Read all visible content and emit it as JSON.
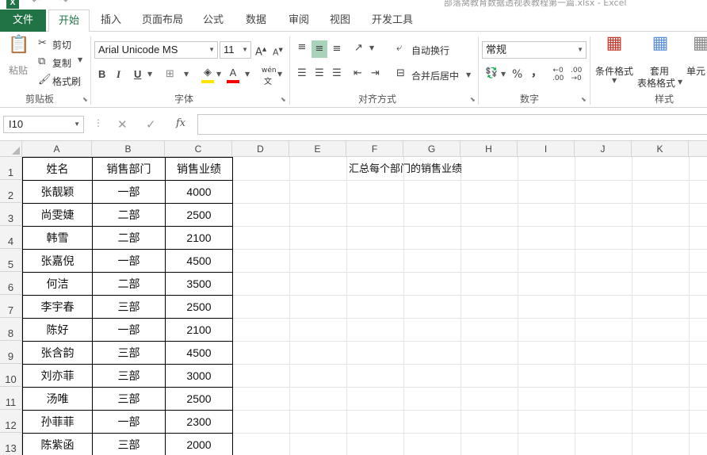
{
  "titlebar": {
    "logo": "X",
    "window_title": "部落窝教育数据透视表教程第一篇.xlsx - Excel"
  },
  "tabs": [
    "文件",
    "开始",
    "插入",
    "页面布局",
    "公式",
    "数据",
    "审阅",
    "视图",
    "开发工具"
  ],
  "ribbon": {
    "clipboard": {
      "paste": "粘贴",
      "cut": "剪切",
      "copy": "复制",
      "format_painter": "格式刷",
      "label": "剪贴板"
    },
    "font": {
      "font_name": "Arial Unicode MS",
      "font_size": "11",
      "bold": "B",
      "italic": "I",
      "underline": "U",
      "phonetic_top": "wén",
      "phonetic_bottom": "文",
      "label": "字体"
    },
    "alignment": {
      "wrap_text": "自动换行",
      "merge_center": "合并后居中",
      "label": "对齐方式"
    },
    "number": {
      "format": "常规",
      "percent": "%",
      "comma": "，",
      "label": "数字"
    },
    "styles": {
      "conditional_formatting": "条件格式",
      "format_table_1": "套用",
      "format_table_2": "表格格式",
      "cell_styles": "单元",
      "label": "样式"
    }
  },
  "formula_bar": {
    "name_box": "I10",
    "fx": "fx",
    "formula": ""
  },
  "grid": {
    "columns": [
      "A",
      "B",
      "C",
      "D",
      "E",
      "F",
      "G",
      "H",
      "I",
      "J",
      "K"
    ],
    "rows": [
      "1",
      "2",
      "3",
      "4",
      "5",
      "6",
      "7",
      "8",
      "9",
      "10",
      "11",
      "12",
      "13"
    ],
    "table": [
      [
        "姓名",
        "销售部门",
        "销售业绩"
      ],
      [
        "张靓颖",
        "一部",
        "4000"
      ],
      [
        "尚雯婕",
        "二部",
        "2500"
      ],
      [
        "韩雪",
        "二部",
        "2100"
      ],
      [
        "张嘉倪",
        "一部",
        "4500"
      ],
      [
        "何洁",
        "二部",
        "3500"
      ],
      [
        "李宇春",
        "三部",
        "2500"
      ],
      [
        "陈好",
        "一部",
        "2100"
      ],
      [
        "张含韵",
        "三部",
        "4500"
      ],
      [
        "刘亦菲",
        "三部",
        "3000"
      ],
      [
        "汤唯",
        "三部",
        "2500"
      ],
      [
        "孙菲菲",
        "一部",
        "2300"
      ],
      [
        "陈紫函",
        "三部",
        "2000"
      ]
    ],
    "note": "汇总每个部门的销售业绩"
  }
}
